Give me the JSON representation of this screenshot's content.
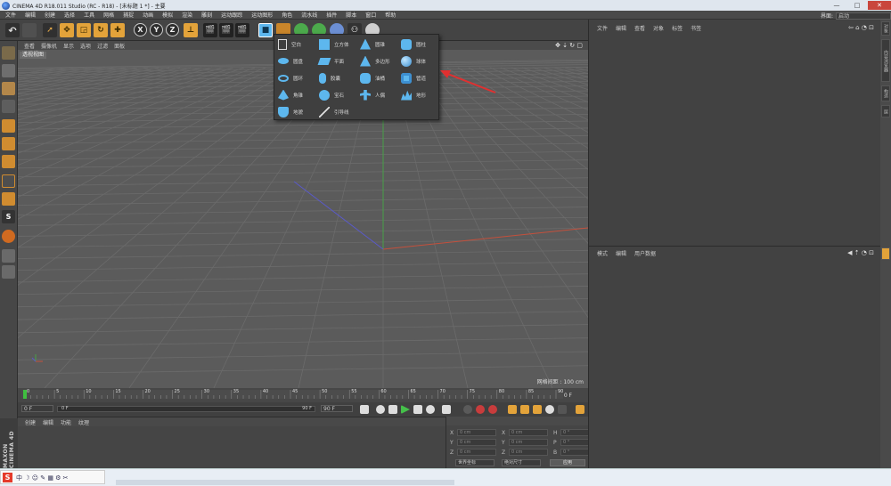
{
  "window": {
    "title": "CINEMA 4D R18.011 Studio (RC - R18) - [未标题 1 *] - 主要",
    "controls": [
      "—",
      "□",
      "✕"
    ]
  },
  "menubar": {
    "items": [
      "文件",
      "编辑",
      "创建",
      "选择",
      "工具",
      "网格",
      "捕捉",
      "动画",
      "模拟",
      "渲染",
      "雕刻",
      "运动跟踪",
      "运动图形",
      "角色",
      "流水线",
      "插件",
      "脚本",
      "窗口",
      "帮助"
    ],
    "layout_label": "界面:",
    "layout_value": "启动"
  },
  "viewport": {
    "menu": [
      "查看",
      "摄像机",
      "显示",
      "选项",
      "过滤",
      "面板"
    ],
    "perspective_label": "透视视图",
    "grid_spacing": "网格间距 : 100 cm",
    "colors": {
      "background": "#5b5b5b",
      "grid": "#6a6a6a",
      "x_axis": "#c4503c",
      "y_axis": "#47a047",
      "z_axis": "#5a5ac8"
    }
  },
  "popup": {
    "items": [
      [
        "空白",
        "立方体",
        "圆锥",
        "圆柱"
      ],
      [
        "圆盘",
        "平面",
        "多边形",
        "球体"
      ],
      [
        "圆环",
        "胶囊",
        "油桶",
        "管道"
      ],
      [
        "角锥",
        "宝石",
        "人偶",
        "地形"
      ],
      [
        "地貌",
        "引导线",
        "",
        ""
      ]
    ]
  },
  "timeline": {
    "ticks": [
      "0",
      "5",
      "10",
      "15",
      "20",
      "25",
      "30",
      "35",
      "40",
      "45",
      "50",
      "55",
      "60",
      "65",
      "70",
      "75",
      "80",
      "85",
      "90"
    ],
    "frame_readout": "0 F",
    "start": "0 F",
    "current": "0 F",
    "end": "90 F",
    "end2": "90 F"
  },
  "material": {
    "menu": [
      "创建",
      "编辑",
      "功能",
      "纹理"
    ]
  },
  "coords": {
    "rows": [
      {
        "a": "X",
        "av": "0 cm",
        "b": "X",
        "bv": "0 cm",
        "c": "H",
        "cv": "0 °"
      },
      {
        "a": "Y",
        "av": "0 cm",
        "b": "Y",
        "bv": "0 cm",
        "c": "P",
        "cv": "0 °"
      },
      {
        "a": "Z",
        "av": "0 cm",
        "b": "Z",
        "bv": "0 cm",
        "c": "B",
        "cv": "0 °"
      }
    ],
    "mode1": "世界坐标",
    "mode2": "绝对尺寸",
    "apply": "应用"
  },
  "objects": {
    "menu": [
      "文件",
      "编辑",
      "查看",
      "对象",
      "标签",
      "书签"
    ]
  },
  "attributes": {
    "menu": [
      "模式",
      "编辑",
      "用户数据"
    ]
  },
  "right_tabs": [
    "对象",
    "内容浏览器",
    "构造",
    "层"
  ],
  "brand": "MAXON CINEMA 4D"
}
